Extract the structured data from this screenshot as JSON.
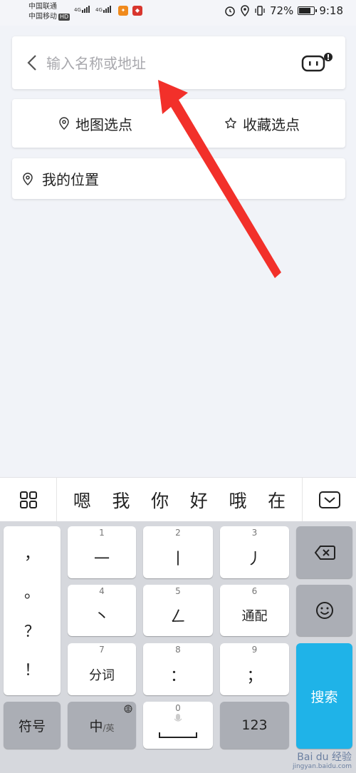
{
  "status_bar": {
    "carrier1": "中国联通",
    "carrier2": "中国移动",
    "hd": "HD",
    "net1": "4G",
    "net2": "4G",
    "battery": "72%",
    "time": "9:18"
  },
  "search": {
    "placeholder": "输入名称或地址"
  },
  "options": {
    "map_pick": "地图选点",
    "favorite_pick": "收藏选点"
  },
  "my_location": "我的位置",
  "keyboard": {
    "candidates": [
      "嗯",
      "我",
      "你",
      "好",
      "哦",
      "在"
    ],
    "punct": [
      "，",
      "。",
      "？",
      "！"
    ],
    "keys": [
      {
        "num": "1",
        "label": "一"
      },
      {
        "num": "2",
        "label": "丨"
      },
      {
        "num": "3",
        "label": "丿"
      },
      {
        "num": "4",
        "label": "丶"
      },
      {
        "num": "5",
        "label": "ㄥ"
      },
      {
        "num": "6",
        "label": "通配"
      },
      {
        "num": "7",
        "label": "分词"
      },
      {
        "num": "8",
        "label": "："
      },
      {
        "num": "9",
        "label": "；"
      }
    ],
    "symbol": "符号",
    "lang_main": "中",
    "lang_alt": "/英",
    "space_num": "0",
    "num_key": "123",
    "search_key": "搜索"
  },
  "watermark": {
    "text": "Bai du 经验",
    "sub": "jingyan.baidu.com"
  },
  "colors": {
    "accent": "#1fb3e8",
    "arrow": "#f2302a"
  }
}
